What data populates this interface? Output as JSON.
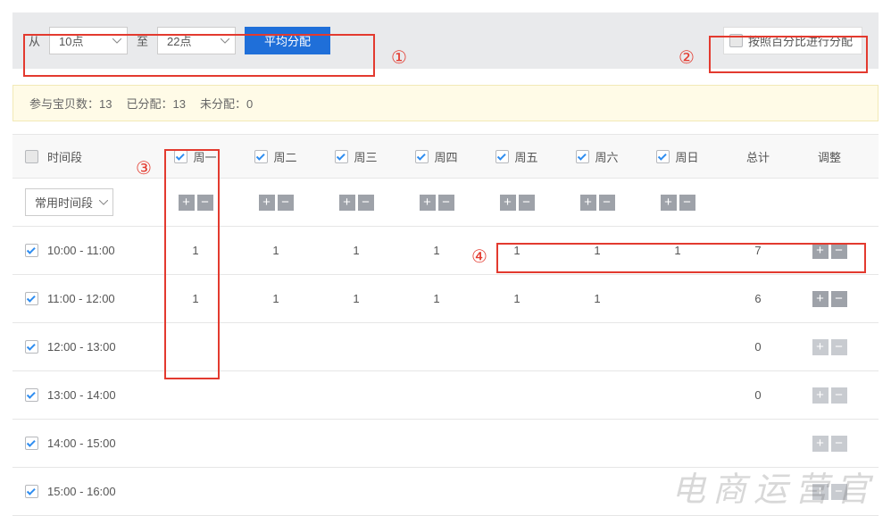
{
  "toolbar": {
    "from_label": "从",
    "from_value": "10点",
    "to_label": "至",
    "to_value": "22点",
    "distribute_btn": "平均分配",
    "percent_label": "按照百分比进行分配"
  },
  "stats": {
    "participating_label": "参与宝贝数：",
    "participating_value": "13",
    "allocated_label": "已分配：",
    "allocated_value": "13",
    "unallocated_label": "未分配：",
    "unallocated_value": "0"
  },
  "table": {
    "col_timeslot": "时间段",
    "days": [
      "周一",
      "周二",
      "周三",
      "周四",
      "周五",
      "周六",
      "周日"
    ],
    "days_checked": [
      true,
      true,
      true,
      true,
      true,
      true,
      true
    ],
    "col_total": "总计",
    "col_adjust": "调整",
    "common_period": "常用时间段",
    "rows": [
      {
        "slot": "10:00 - 11:00",
        "checked": true,
        "vals": [
          "1",
          "1",
          "1",
          "1",
          "1",
          "1",
          "1"
        ],
        "total": "7"
      },
      {
        "slot": "11:00 - 12:00",
        "checked": true,
        "vals": [
          "1",
          "1",
          "1",
          "1",
          "1",
          "1",
          ""
        ],
        "total": "6"
      },
      {
        "slot": "12:00 - 13:00",
        "checked": true,
        "vals": [
          "",
          "",
          "",
          "",
          "",
          "",
          ""
        ],
        "total": "0"
      },
      {
        "slot": "13:00 - 14:00",
        "checked": true,
        "vals": [
          "",
          "",
          "",
          "",
          "",
          "",
          ""
        ],
        "total": "0"
      },
      {
        "slot": "14:00 - 15:00",
        "checked": true,
        "vals": [
          "",
          "",
          "",
          "",
          "",
          "",
          ""
        ],
        "total": ""
      },
      {
        "slot": "15:00 - 16:00",
        "checked": true,
        "vals": [
          "",
          "",
          "",
          "",
          "",
          "",
          ""
        ],
        "total": ""
      }
    ]
  },
  "annotations": {
    "n1": "①",
    "n2": "②",
    "n3": "③",
    "n4": "④"
  },
  "watermark": "电商运营官"
}
